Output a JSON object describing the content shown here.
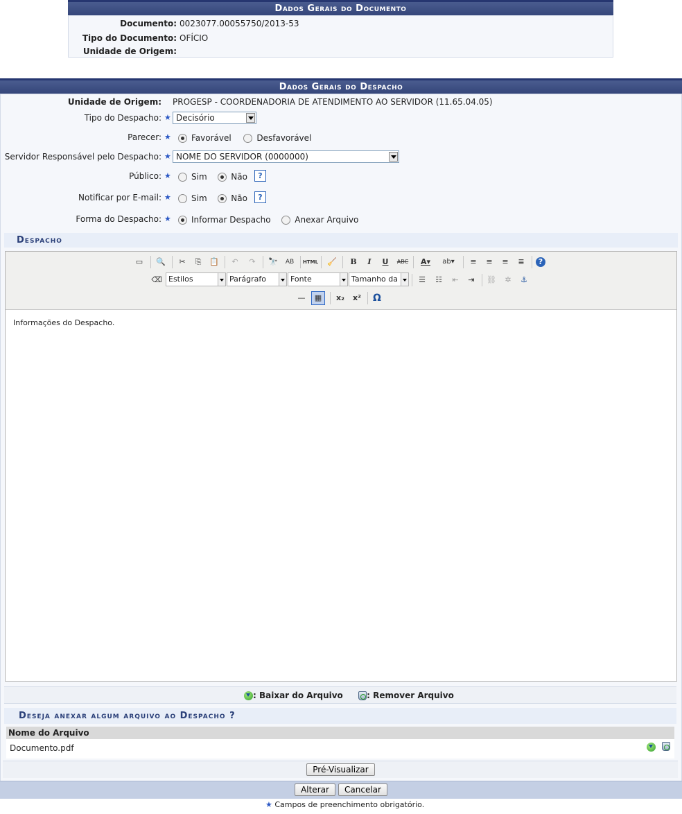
{
  "documento_panel": {
    "title": "Dados Gerais do Documento",
    "documento_label": "Documento:",
    "documento_value": "0023077.00055750/2013-53",
    "tipo_label": "Tipo do Documento:",
    "tipo_value": "OFÍCIO",
    "unidade_label": "Unidade de Origem:",
    "unidade_value": ""
  },
  "despacho_panel": {
    "title": "Dados Gerais do Despacho",
    "unidade_label": "Unidade de Origem:",
    "unidade_value": "PROGESP - COORDENADORIA DE ATENDIMENTO AO SERVIDOR (11.65.04.05)",
    "tipo_label": "Tipo do Despacho:",
    "tipo_value": "Decisório",
    "parecer_label": "Parecer:",
    "parecer_opt1": "Favorável",
    "parecer_opt2": "Desfavorável",
    "parecer_selected": "Favorável",
    "servidor_label": "Servidor Responsável pelo Despacho:",
    "servidor_value": "NOME DO SERVIDOR (0000000)",
    "publico_label": "Público:",
    "publico_opt1": "Sim",
    "publico_opt2": "Não",
    "publico_selected": "Não",
    "notificar_label": "Notificar por E-mail:",
    "notificar_opt1": "Sim",
    "notificar_opt2": "Não",
    "notificar_selected": "Não",
    "forma_label": "Forma do Despacho:",
    "forma_opt1": "Informar Despacho",
    "forma_opt2": "Anexar Arquivo",
    "forma_selected": "Informar Despacho",
    "help_glyph": "?"
  },
  "editor": {
    "section_title": "Despacho",
    "toolbar": {
      "estilos": "Estilos",
      "paragrafo": "Parágrafo",
      "fonte": "Fonte",
      "tamanho": "Tamanho da Fonte",
      "bold": "B",
      "italic": "I",
      "underline": "U",
      "strike": "ABC",
      "html": "HTML",
      "subscript": "x₂",
      "superscript": "x²",
      "omega": "Ω"
    },
    "content": "Informações do Despacho."
  },
  "legend": {
    "baixar": ": Baixar do Arquivo",
    "remover": ": Remover Arquivo"
  },
  "anexo": {
    "title": "Deseja anexar algum arquivo ao Despacho ?",
    "column_header": "Nome do Arquivo",
    "files": [
      "Documento.pdf"
    ]
  },
  "buttons": {
    "preview": "Pré-Visualizar",
    "alterar": "Alterar",
    "cancelar": "Cancelar"
  },
  "footer_note": "Campos de preenchimento obrigatório.",
  "colors": {
    "caption": "#3b4c82",
    "panel": "#f5f7fb",
    "required": "#2a57c4"
  }
}
